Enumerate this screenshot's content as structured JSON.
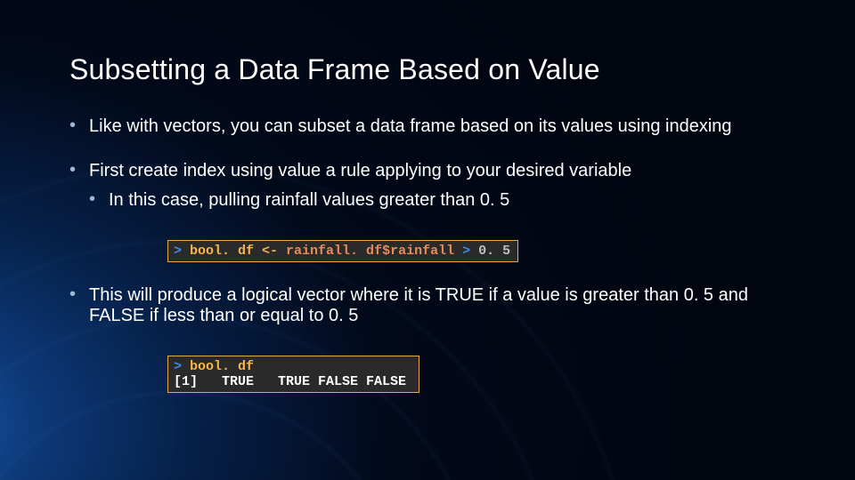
{
  "title": "Subsetting a Data Frame Based on Value",
  "bullets": {
    "b1": "Like with vectors, you can subset a data frame based on its values using indexing",
    "b2": "First create index using value a rule applying to your desired variable",
    "b2sub": "In this case, pulling rainfall values greater than 0. 5",
    "b3": "This will produce a logical vector where it is TRUE if a value is greater than 0. 5 and FALSE if less than or equal to 0. 5"
  },
  "code1": {
    "prompt": "> ",
    "lhs": "bool. df",
    "assign": " <- ",
    "rhs": "rainfall. df$rainfall",
    "op": " > ",
    "num": "0. 5"
  },
  "code2": {
    "prompt": "> ",
    "cmd": "bool. df",
    "idx": "[1]",
    "vals": "   TRUE   TRUE FALSE FALSE"
  }
}
